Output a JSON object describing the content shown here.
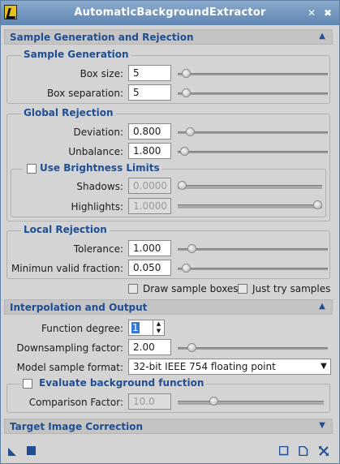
{
  "window": {
    "title": "AutomaticBackgroundExtractor",
    "pin_symbol": "✖",
    "close_symbol": "✖"
  },
  "sections": {
    "sample_gen_rej": {
      "title": "Sample Generation and Rejection"
    },
    "interp_output": {
      "title": "Interpolation and Output"
    },
    "target_corr": {
      "title": "Target Image Correction"
    }
  },
  "sample_generation": {
    "title": "Sample Generation",
    "box_size": {
      "label": "Box size:",
      "value": "5",
      "position": 0.03
    },
    "box_separation": {
      "label": "Box separation:",
      "value": "5",
      "position": 0.03
    }
  },
  "global_rejection": {
    "title": "Global Rejection",
    "deviation": {
      "label": "Deviation:",
      "value": "0.800",
      "position": 0.06
    },
    "unbalance": {
      "label": "Unbalance:",
      "value": "1.800",
      "position": 0.02
    }
  },
  "brightness_limits": {
    "title": "Use Brightness Limits",
    "checked": false,
    "shadows": {
      "label": "Shadows:",
      "value": "0.0000",
      "position": 0.0
    },
    "highlights": {
      "label": "Highlights:",
      "value": "1.0000",
      "position": 1.0
    }
  },
  "local_rejection": {
    "title": "Local Rejection",
    "tolerance": {
      "label": "Tolerance:",
      "value": "1.000",
      "position": 0.07
    },
    "min_valid_fraction": {
      "label": "Minimun valid fraction:",
      "value": "0.050",
      "position": 0.03
    }
  },
  "options": {
    "draw_sample_boxes": {
      "label": "Draw sample boxes",
      "checked": false
    },
    "just_try_samples": {
      "label": "Just try samples",
      "checked": false
    }
  },
  "interpolation": {
    "function_degree": {
      "label": "Function degree:",
      "value": "1"
    },
    "downsampling_factor": {
      "label": "Downsampling factor:",
      "value": "2.00",
      "position": 0.07
    },
    "model_sample_format": {
      "label": "Model sample format:",
      "value": "32-bit IEEE 754 floating point"
    }
  },
  "evaluate_bg": {
    "title": "Evaluate background function",
    "checked": false,
    "comparison_factor": {
      "label": "Comparison Factor:",
      "value": "10.0",
      "position": 0.23
    }
  },
  "colors": {
    "accent": "#1f4e93",
    "titlebar": "#6f92bb",
    "panel": "#d4d4d4"
  }
}
